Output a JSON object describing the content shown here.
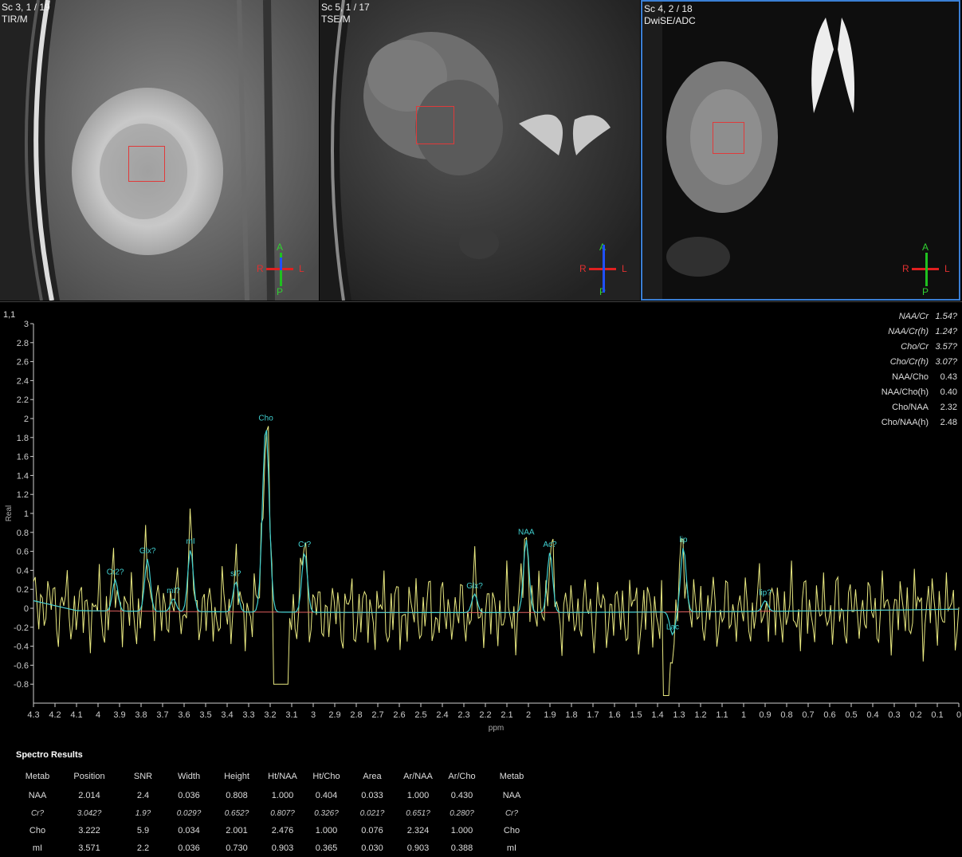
{
  "viewers": [
    {
      "title": "Sc 3, 1 / 19",
      "subtitle": "TIR/M",
      "orient": {
        "a": "A",
        "p": "P",
        "r": "R",
        "l": "L"
      }
    },
    {
      "title": "Sc 5, 1 / 17",
      "subtitle": "TSE/M",
      "orient": {
        "a": "A",
        "p": "P",
        "r": "R",
        "l": "L"
      }
    },
    {
      "title": "Sc 4, 2 / 18",
      "subtitle": "DwiSE/ADC",
      "orient": {
        "a": "A",
        "p": "P",
        "r": "R",
        "l": "L"
      }
    }
  ],
  "spectrum": {
    "label": "1,1",
    "ylabel": "Real",
    "xlabel": "ppm",
    "yticks": [
      "3",
      "2.8",
      "2.6",
      "2.4",
      "2.2",
      "2",
      "1.8",
      "1.6",
      "1.4",
      "1.2",
      "1",
      "0.8",
      "0.6",
      "0.4",
      "0.2",
      "0",
      "-0.2",
      "-0.4",
      "-0.6",
      "-0.8"
    ],
    "xticks": [
      "4.3",
      "4.2",
      "4.1",
      "4",
      "3.9",
      "3.8",
      "3.7",
      "3.6",
      "3.5",
      "3.4",
      "3.3",
      "3.2",
      "3.1",
      "3",
      "2.9",
      "2.8",
      "2.7",
      "2.6",
      "2.5",
      "2.4",
      "2.3",
      "2.2",
      "2.1",
      "2",
      "1.9",
      "1.8",
      "1.7",
      "1.6",
      "1.5",
      "1.4",
      "1.3",
      "1.2",
      "1.1",
      "1",
      "0.9",
      "0.8",
      "0.7",
      "0.6",
      "0.5",
      "0.4",
      "0.3",
      "0.2",
      "0.1",
      "0"
    ],
    "peaks": [
      {
        "label": "Cr2?",
        "ppm": 3.92,
        "y": 0.3
      },
      {
        "label": "Glx?",
        "ppm": 3.77,
        "y": 0.52
      },
      {
        "label": "mI?",
        "ppm": 3.65,
        "y": 0.1
      },
      {
        "label": "mI",
        "ppm": 3.57,
        "y": 0.62
      },
      {
        "label": "sI?",
        "ppm": 3.36,
        "y": 0.28
      },
      {
        "label": "Cho",
        "ppm": 3.22,
        "y": 1.92
      },
      {
        "label": "Cr?",
        "ppm": 3.04,
        "y": 0.59
      },
      {
        "label": "Glx?",
        "ppm": 2.25,
        "y": 0.15
      },
      {
        "label": "NAA",
        "ppm": 2.01,
        "y": 0.72
      },
      {
        "label": "Ac?",
        "ppm": 1.9,
        "y": 0.59
      },
      {
        "label": "Lac",
        "ppm": 1.33,
        "y": -0.28
      },
      {
        "label": "lip",
        "ppm": 1.28,
        "y": 0.64
      },
      {
        "label": "lip?",
        "ppm": 0.9,
        "y": 0.08
      }
    ],
    "colors": {
      "raw": "#e8e880",
      "fit": "#40d0d0",
      "baseline": "#e06060",
      "axis": "#cfcfcf"
    }
  },
  "ratios": [
    {
      "name": "NAA/Cr",
      "value": "1.54?",
      "uncertain": true
    },
    {
      "name": "NAA/Cr(h)",
      "value": "1.24?",
      "uncertain": true
    },
    {
      "name": "Cho/Cr",
      "value": "3.57?",
      "uncertain": true
    },
    {
      "name": "Cho/Cr(h)",
      "value": "3.07?",
      "uncertain": true
    },
    {
      "name": "NAA/Cho",
      "value": "0.43",
      "uncertain": false
    },
    {
      "name": "NAA/Cho(h)",
      "value": "0.40",
      "uncertain": false
    },
    {
      "name": "Cho/NAA",
      "value": "2.32",
      "uncertain": false
    },
    {
      "name": "Cho/NAA(h)",
      "value": "2.48",
      "uncertain": false
    }
  ],
  "results": {
    "title": "Spectro Results",
    "columns": [
      "Metab",
      "Position",
      "SNR",
      "Width",
      "Height",
      "Ht/NAA",
      "Ht/Cho",
      "Area",
      "Ar/NAA",
      "Ar/Cho",
      "Metab"
    ],
    "rows": [
      {
        "uncertain": false,
        "cells": [
          "NAA",
          "2.014",
          "2.4",
          "0.036",
          "0.808",
          "1.000",
          "0.404",
          "0.033",
          "1.000",
          "0.430",
          "NAA"
        ]
      },
      {
        "uncertain": true,
        "cells": [
          "Cr?",
          "3.042?",
          "1.9?",
          "0.029?",
          "0.652?",
          "0.807?",
          "0.326?",
          "0.021?",
          "0.651?",
          "0.280?",
          "Cr?"
        ]
      },
      {
        "uncertain": false,
        "cells": [
          "Cho",
          "3.222",
          "5.9",
          "0.034",
          "2.001",
          "2.476",
          "1.000",
          "0.076",
          "2.324",
          "1.000",
          "Cho"
        ]
      },
      {
        "uncertain": false,
        "cells": [
          "mI",
          "3.571",
          "2.2",
          "0.036",
          "0.730",
          "0.903",
          "0.365",
          "0.030",
          "0.903",
          "0.388",
          "mI"
        ]
      }
    ]
  }
}
